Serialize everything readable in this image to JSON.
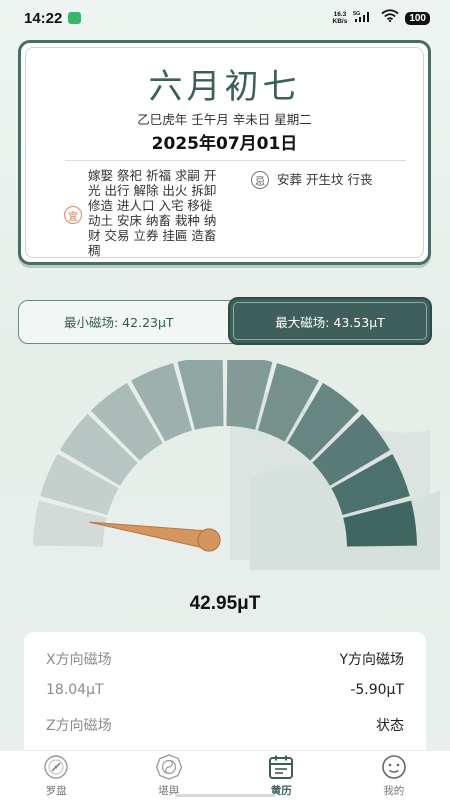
{
  "status_bar": {
    "time": "14:22",
    "net_speed_value": "16.3",
    "net_speed_unit": "KB/s",
    "battery": "100",
    "network": "5G"
  },
  "calendar": {
    "lunar_date": "六月初七",
    "ganzhi": "乙巳虎年 壬午月 辛未日 星期二",
    "solar_date": "2025年07月01日",
    "yi_label": "宜",
    "yi_items": "嫁娶 祭祀 祈福 求嗣 开光 出行 解除 出火 拆卸 修造 进人口 入宅 移徙 动土 安床 纳畜 栽种 纳财 交易 立券 挂匾 造畜稠",
    "ji_label": "忌",
    "ji_items": "安葬 开生坟 行丧"
  },
  "magnetic_range": {
    "min_label": "最小磁场: 42.23μT",
    "max_label": "最大磁场: 43.53μT"
  },
  "gauge": {
    "value_text": "42.95μT",
    "needle_fraction": 0.06,
    "segments": 12,
    "colors": {
      "light": "#d2dbd8",
      "dark": "#3f6661",
      "needle": "#d4955f",
      "needle_stroke": "#b87540"
    }
  },
  "data_panel": {
    "x_label": "X方向磁场",
    "y_label": "Y方向磁场",
    "x_value": "18.04μT",
    "y_value": "-5.90μT",
    "z_label": "Z方向磁场",
    "status_label": "状态"
  },
  "bottom_nav": {
    "items": [
      {
        "label": "罗盘",
        "icon": "compass-icon"
      },
      {
        "label": "堪舆",
        "icon": "bagua-icon"
      },
      {
        "label": "黄历",
        "icon": "calendar-icon"
      },
      {
        "label": "我的",
        "icon": "profile-icon"
      }
    ],
    "active_index": 2
  },
  "theme": {
    "accent": "#3d5f5a",
    "background": "#e8efec"
  }
}
